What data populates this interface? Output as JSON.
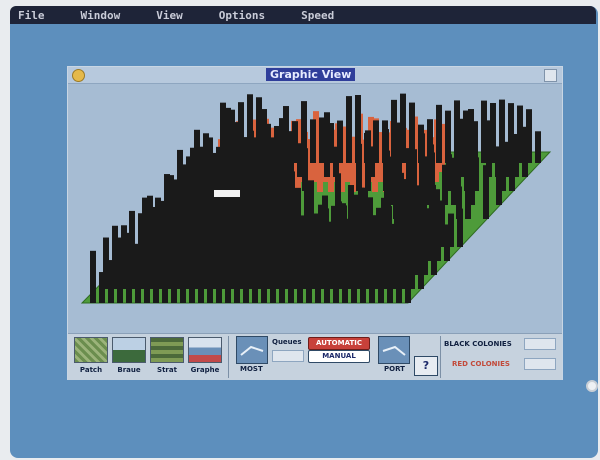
{
  "menubar": {
    "items": [
      "File",
      "Window",
      "View",
      "Options",
      "Speed"
    ]
  },
  "window": {
    "title": "Graphic View"
  },
  "toolbar": {
    "tools": [
      {
        "label": "Patch",
        "icon": "patch-grid-icon"
      },
      {
        "label": "Braue",
        "icon": "wave-icon"
      },
      {
        "label": "Strat",
        "icon": "strata-icon"
      },
      {
        "label": "Graphe",
        "icon": "graph-picture-icon"
      }
    ],
    "left_button_label": "MOST",
    "right_button_label": "PORT",
    "queue_label": "Queues",
    "mode_auto": "AUTOMATIC",
    "mode_manual": "MANUAL",
    "help_label": "?",
    "black_colonies_label": "BLACK COLONIES",
    "red_colonies_label": "RED COLONIES"
  },
  "colors": {
    "desktop": "#5d8fbd",
    "window_bg": "#a6bcd3",
    "ground": "#4e9b3a",
    "black_colony": "#1a1a1a",
    "red_colony": "#d9633e",
    "title_highlight": "#2f3e9a"
  }
}
